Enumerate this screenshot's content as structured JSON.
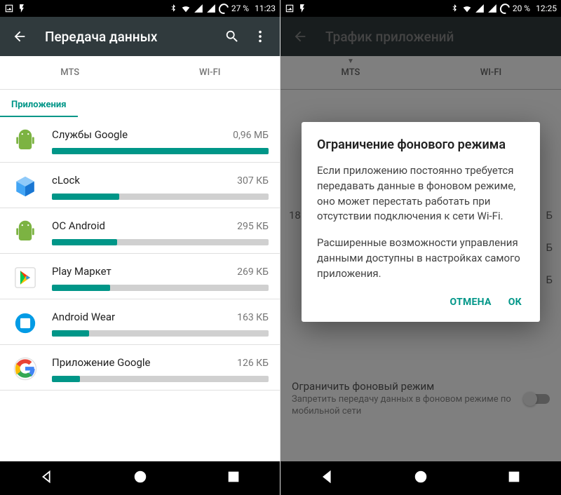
{
  "colors": {
    "accent": "#009688",
    "toolbar": "#303a3d"
  },
  "left": {
    "status": {
      "battery": "27 %",
      "time": "11:23"
    },
    "toolbar": {
      "title": "Передача данных"
    },
    "tabs": {
      "t1": "MTS",
      "t2": "WI-FI"
    },
    "section": "Приложения",
    "apps": [
      {
        "name": "Службы Google",
        "value": "0,96 МБ",
        "pct": 100
      },
      {
        "name": "cLock",
        "value": "307 КБ",
        "pct": 31
      },
      {
        "name": "ОС Android",
        "value": "295 КБ",
        "pct": 30
      },
      {
        "name": "Play Маркет",
        "value": "269 КБ",
        "pct": 27
      },
      {
        "name": "Android Wear",
        "value": "163 КБ",
        "pct": 17
      },
      {
        "name": "Приложение Google",
        "value": "126 КБ",
        "pct": 13
      }
    ]
  },
  "right": {
    "status": {
      "battery": "20 %",
      "time": "12:25"
    },
    "toolbar": {
      "title": "Трафик приложений"
    },
    "tabs": {
      "t1": "MTS",
      "t2": "WI-FI"
    },
    "obscured_left": "18",
    "obscured_right": "Б",
    "dialog": {
      "title": "Ограничение фонового режима",
      "p1": "Если приложению постоянно требуется передавать данные в фоновом режиме, оно может перестать работать при отсутствии подключения к сети Wi-Fi.",
      "p2": "Расширенные возможности управления данными доступны в настройках самого приложения.",
      "cancel": "ОТМЕНА",
      "ok": "ОК"
    },
    "bg_setting": {
      "title": "Ограничить фоновый режим",
      "subtitle": "Запретить передачу данных в фоновом режиме по мобильной сети"
    }
  }
}
